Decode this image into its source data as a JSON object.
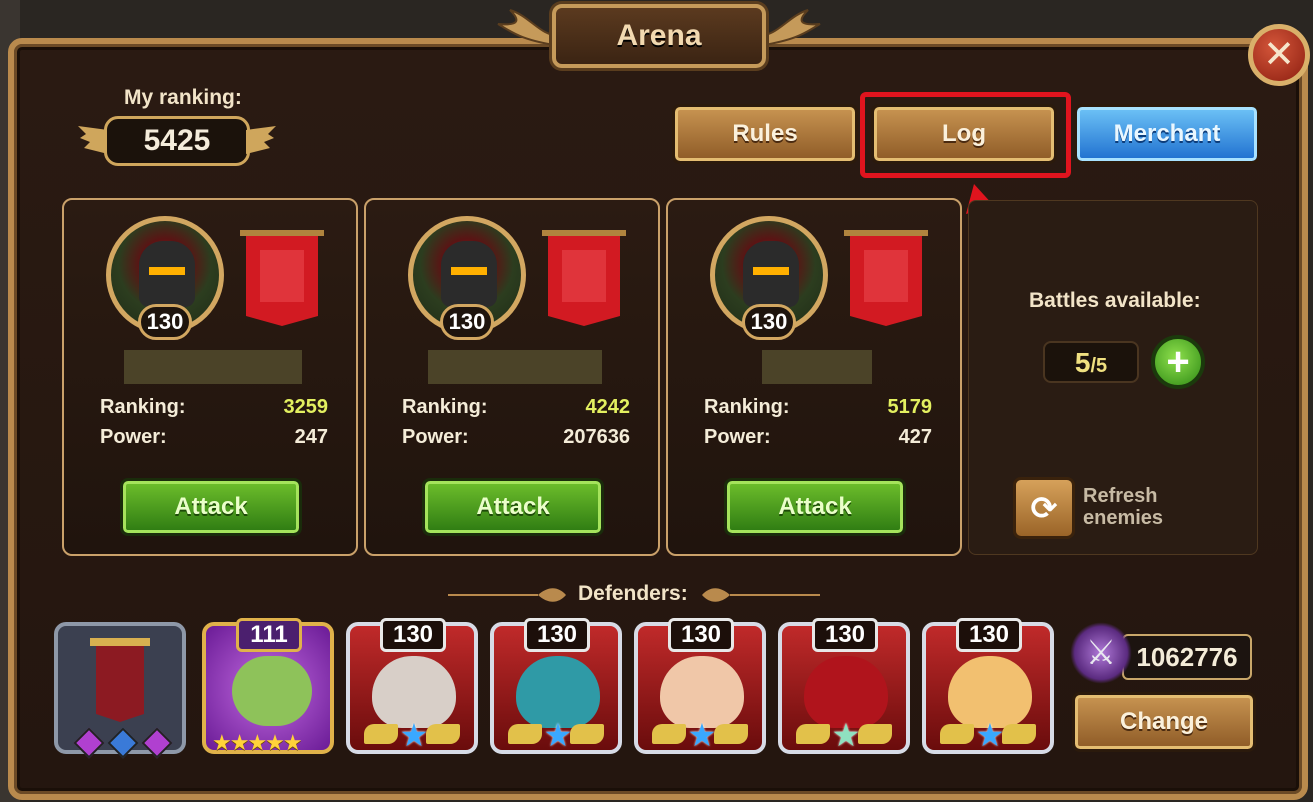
{
  "window": {
    "title": "Arena"
  },
  "my_ranking": {
    "label": "My ranking:",
    "value": "5425"
  },
  "top_buttons": {
    "rules": "Rules",
    "log": "Log",
    "merchant": "Merchant"
  },
  "opponents": [
    {
      "level": "130",
      "ranking_label": "Ranking:",
      "ranking": "3259",
      "power_label": "Power:",
      "power": "247",
      "attack": "Attack"
    },
    {
      "level": "130",
      "ranking_label": "Ranking:",
      "ranking": "4242",
      "power_label": "Power:",
      "power": "207636",
      "attack": "Attack"
    },
    {
      "level": "130",
      "ranking_label": "Ranking:",
      "ranking": "5179",
      "power_label": "Power:",
      "power": "427",
      "attack": "Attack"
    }
  ],
  "battles": {
    "label": "Battles available:",
    "current": "5",
    "max": "/5"
  },
  "refresh": {
    "line1": "Refresh",
    "line2": "enemies"
  },
  "defenders": {
    "label": "Defenders:",
    "pet_level": "111",
    "pet_stars": "★★★★★",
    "heroes": [
      {
        "level": "130",
        "name": "hero-elf-archer"
      },
      {
        "level": "130",
        "name": "hero-hooded-undead"
      },
      {
        "level": "130",
        "name": "hero-dark-haired-warrior"
      },
      {
        "level": "130",
        "name": "hero-red-hood-mage"
      },
      {
        "level": "130",
        "name": "hero-blonde-elf"
      }
    ],
    "team_power": "1062776",
    "change": "Change"
  },
  "colors": {
    "accent_gold": "#caa16a",
    "ranking_value": "#e3f060",
    "highlight_red": "#e0141e",
    "attack_green": "#4ea01e",
    "merchant_blue": "#2f86e0"
  }
}
